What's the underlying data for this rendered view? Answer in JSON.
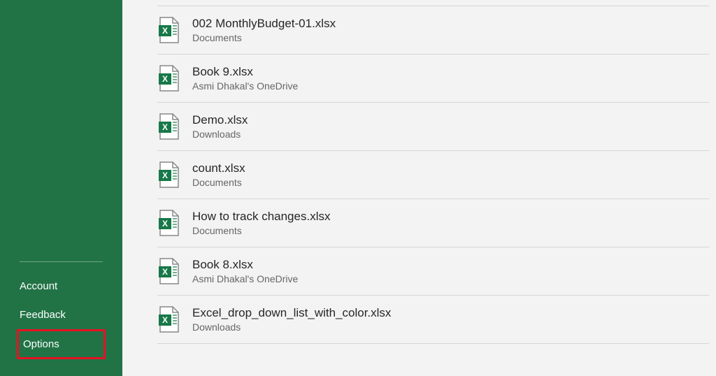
{
  "sidebar": {
    "items": [
      {
        "label": "Account"
      },
      {
        "label": "Feedback"
      },
      {
        "label": "Options"
      }
    ]
  },
  "files": [
    {
      "name": "002 MonthlyBudget-01.xlsx",
      "location": "Documents"
    },
    {
      "name": "Book 9.xlsx",
      "location": "Asmi Dhakal's OneDrive"
    },
    {
      "name": "Demo.xlsx",
      "location": "Downloads"
    },
    {
      "name": "count.xlsx",
      "location": "Documents"
    },
    {
      "name": "How to track changes.xlsx",
      "location": "Documents"
    },
    {
      "name": "Book 8.xlsx",
      "location": "Asmi Dhakal's OneDrive"
    },
    {
      "name": "Excel_drop_down_list_with_color.xlsx",
      "location": "Downloads"
    }
  ]
}
